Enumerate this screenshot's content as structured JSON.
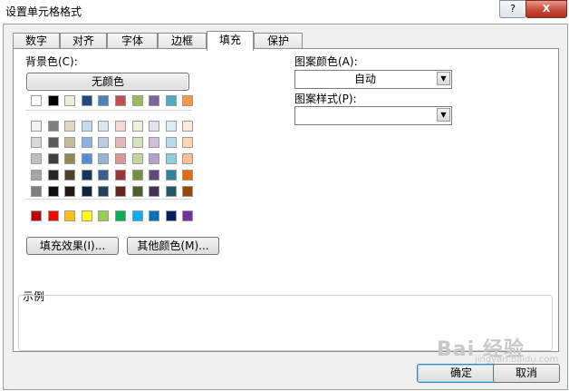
{
  "window": {
    "title": "设置单元格格式",
    "help_label": "?",
    "close_label": "X"
  },
  "tabs": [
    {
      "label": "数字",
      "active": false
    },
    {
      "label": "对齐",
      "active": false
    },
    {
      "label": "字体",
      "active": false
    },
    {
      "label": "边框",
      "active": false
    },
    {
      "label": "填充",
      "active": true
    },
    {
      "label": "保护",
      "active": false
    }
  ],
  "fill": {
    "background_label": "背景色(C):",
    "no_color_label": "无颜色",
    "fill_effects_label": "填充效果(I)...",
    "more_colors_label": "其他颜色(M)...",
    "pattern_color_label": "图案颜色(A):",
    "pattern_color_value": "自动",
    "pattern_style_label": "图案样式(P):",
    "pattern_style_value": "",
    "sample_label": "示例"
  },
  "palette": {
    "theme_row": [
      "#ffffff",
      "#000000",
      "#eeece1",
      "#1f497d",
      "#4f81bd",
      "#c0504d",
      "#9bbb59",
      "#8064a2",
      "#4bacc6",
      "#f79646"
    ],
    "tints": [
      [
        "#f2f2f2",
        "#7f7f7f",
        "#ddd9c3",
        "#c6d9f0",
        "#dbe5f1",
        "#f2dcdb",
        "#ebf1dd",
        "#e5e0ec",
        "#dbeef3",
        "#fdeada"
      ],
      [
        "#d8d8d8",
        "#595959",
        "#c4bd97",
        "#8db3e2",
        "#b8cce4",
        "#e5b9b7",
        "#d7e3bc",
        "#ccc1d9",
        "#b7dde8",
        "#fbd5b5"
      ],
      [
        "#bfbfbf",
        "#3f3f3f",
        "#938953",
        "#548dd4",
        "#95b3d7",
        "#d99694",
        "#c3d69b",
        "#b2a2c7",
        "#92cddc",
        "#fac08f"
      ],
      [
        "#a5a5a5",
        "#262626",
        "#494429",
        "#17365d",
        "#366092",
        "#953734",
        "#76923c",
        "#5f497a",
        "#31859b",
        "#e36c09"
      ],
      [
        "#7f7f7f",
        "#0c0c0c",
        "#1d1b10",
        "#0f243e",
        "#244061",
        "#632423",
        "#4f6128",
        "#3f3151",
        "#205867",
        "#974806"
      ]
    ],
    "standard": [
      "#c00000",
      "#ff0000",
      "#ffc000",
      "#ffff00",
      "#92d050",
      "#00b050",
      "#00b0f0",
      "#0070c0",
      "#002060",
      "#7030a0"
    ]
  },
  "footer": {
    "ok_label": "确定",
    "cancel_label": "取消"
  },
  "watermark": {
    "main": "Bai 经验",
    "sub": "jingyan.baidu.com"
  }
}
